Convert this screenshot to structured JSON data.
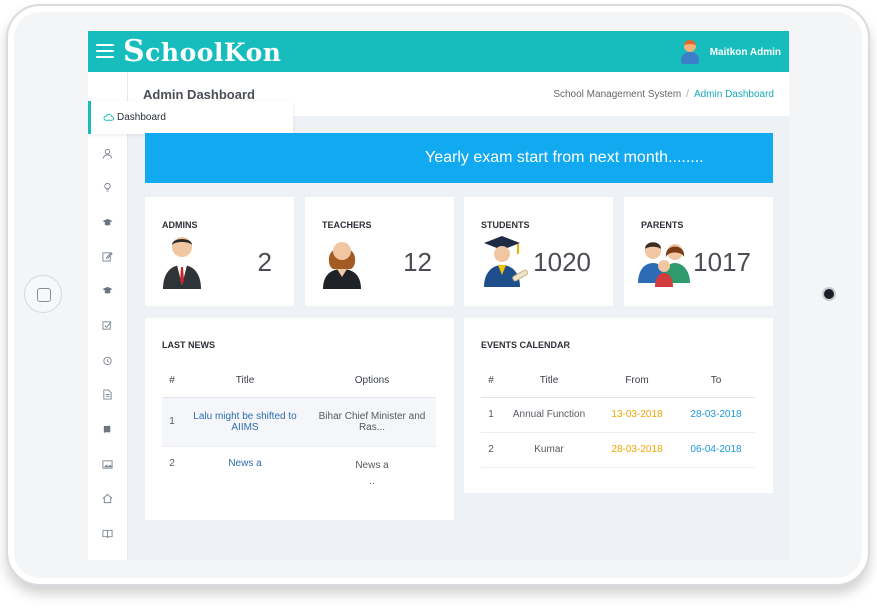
{
  "brand": {
    "logo_first": "S",
    "logo_rest": "choolKon"
  },
  "user": {
    "name": "Maitkon Admin"
  },
  "header": {
    "page_title": "Admin Dashboard",
    "breadcrumb": [
      "School Management System",
      "Admin Dashboard"
    ]
  },
  "sidebar": {
    "dashboard_label": "Dashboard",
    "icons": [
      "user-icon",
      "bulb-icon",
      "graduation-cap-icon",
      "edit-icon",
      "graduation-cap-icon",
      "check-square-icon",
      "alarm-icon",
      "document-icon",
      "book-icon",
      "image-icon",
      "home-icon",
      "open-book-icon"
    ]
  },
  "banner": {
    "text": "Yearly exam start from next month........"
  },
  "stats": [
    {
      "label": "ADMINS",
      "count": "2"
    },
    {
      "label": "TEACHERS",
      "count": "12"
    },
    {
      "label": "STUDENTS",
      "count": "1020"
    },
    {
      "label": "PARENTS",
      "count": "1017"
    }
  ],
  "news": {
    "title": "LAST NEWS",
    "columns": [
      "#",
      "Title",
      "Options"
    ],
    "rows": [
      {
        "num": "1",
        "title": "Lalu might be shifted to AIIMS",
        "option": "Bihar Chief Minister and Ras..."
      },
      {
        "num": "2",
        "title": "News a",
        "option": "News a",
        "option_extra": ".."
      }
    ]
  },
  "events": {
    "title": "EVENTS CALENDAR",
    "columns": [
      "#",
      "Title",
      "From",
      "To"
    ],
    "rows": [
      {
        "num": "1",
        "title": "Annual Function",
        "from": "13-03-2018",
        "to": "28-03-2018"
      },
      {
        "num": "2",
        "title": "Kumar",
        "from": "28-03-2018",
        "to": "06-04-2018"
      }
    ]
  },
  "colors": {
    "topbar": "#17bdbd",
    "banner": "#11a9f0",
    "from_date": "#f0a500",
    "to_date": "#1b98d8"
  }
}
